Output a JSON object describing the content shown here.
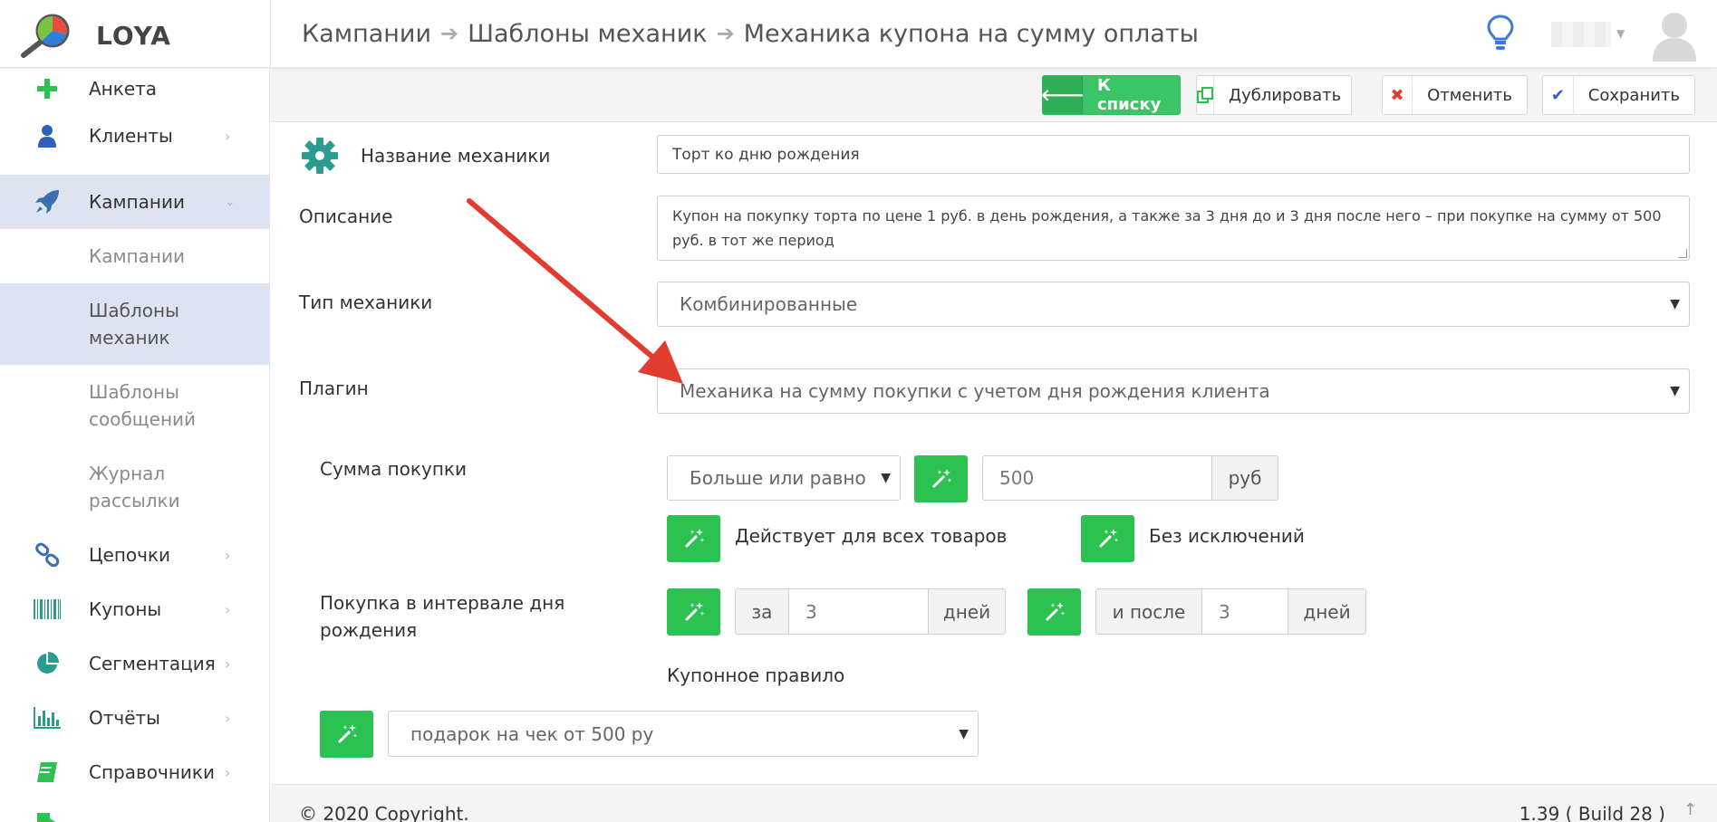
{
  "app": {
    "name": "LOYA"
  },
  "breadcrumb": [
    "Кампании",
    "Шаблоны механик",
    "Механика купона на сумму оплаты"
  ],
  "sidebar": {
    "items": [
      {
        "label": "Анкета",
        "icon": "plus-icon"
      },
      {
        "label": "Клиенты",
        "icon": "user-icon"
      },
      {
        "label": "Кампании",
        "icon": "rocket-icon"
      },
      {
        "label": "Цепочки",
        "icon": "link-icon"
      },
      {
        "label": "Купоны",
        "icon": "barcode-icon"
      },
      {
        "label": "Сегментация",
        "icon": "pie-chart-icon"
      },
      {
        "label": "Отчёты",
        "icon": "bar-chart-icon"
      },
      {
        "label": "Справочники",
        "icon": "book-icon"
      }
    ],
    "subitems": [
      {
        "label_line1": "Кампании",
        "label_line2": ""
      },
      {
        "label_line1": "Шаблоны",
        "label_line2": "механик"
      },
      {
        "label_line1": "Шаблоны",
        "label_line2": "сообщений"
      },
      {
        "label_line1": "Журнал",
        "label_line2": "рассылки"
      }
    ]
  },
  "toolbar": {
    "back_label": "К списку",
    "duplicate_label": "Дублировать",
    "cancel_label": "Отменить",
    "save_label": "Сохранить"
  },
  "form": {
    "name_label": "Название механики",
    "name_value": "Торт ко дню рождения",
    "description_label": "Описание",
    "description_value": "Купон на покупку торта по цене 1 руб. в день рождения, а также за 3 дня до и 3 дня после него – при покупке на сумму от 500 руб. в тот же период",
    "type_label": "Тип механики",
    "type_value": "Комбинированные",
    "plugin_label": "Плагин",
    "plugin_value": "Механика на сумму покупки с учетом дня рождения клиента",
    "sum_label": "Сумма покупки",
    "sum_operator": "Больше или равно",
    "sum_value": "500",
    "sum_unit": "руб",
    "all_goods_label": "Действует для всех товаров",
    "no_exceptions_label": "Без исключений",
    "interval_label_line1": "Покупка в интервале дня",
    "interval_label_line2": "рождения",
    "before_prefix": "за",
    "before_value": "3",
    "before_unit": "дней",
    "after_prefix": "и после",
    "after_value": "3",
    "after_unit": "дней",
    "coupon_rule_label": "Купонное правило",
    "coupon_rule_value": "подарок на чек от 500 ру"
  },
  "footer": {
    "copyright": "© 2020 Copyright.",
    "version": "1.39 ( Build 28 )"
  },
  "colors": {
    "green": "#2cc252",
    "annotation_arrow": "#e23b30",
    "active_nav": "#dde3f0"
  }
}
